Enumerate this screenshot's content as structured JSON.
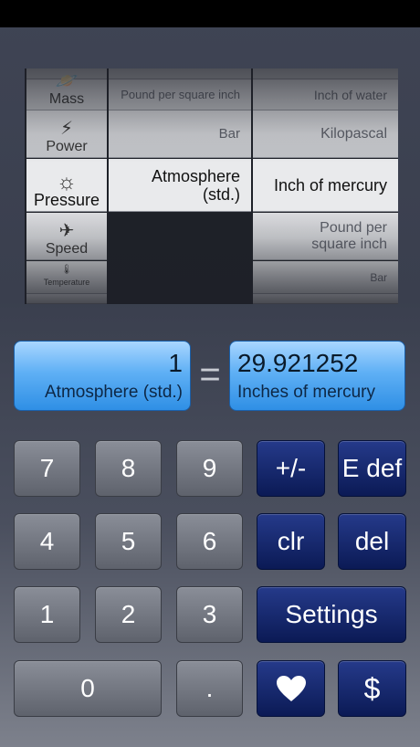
{
  "picker": {
    "categories": [
      {
        "label": "",
        "icon": "",
        "icon_name": "top-partial-icon"
      },
      {
        "label": "Mass",
        "icon": "🪐",
        "icon_name": "planet-icon"
      },
      {
        "label": "Power",
        "icon": "⚡",
        "icon_name": "lightning-icon"
      },
      {
        "label": "Pressure",
        "icon": "☼",
        "icon_name": "sun-icon"
      },
      {
        "label": "Speed",
        "icon": "✈",
        "icon_name": "airplane-icon"
      },
      {
        "label": "Temperature",
        "icon": "🌡",
        "icon_name": "thermometer-icon"
      }
    ],
    "from_units": [
      "Pound per square inch",
      "Bar",
      "Atmosphere (std.)"
    ],
    "to_units": [
      "Inch of water",
      "Kilopascal",
      "Inch of mercury",
      "Pound per square inch",
      "Bar"
    ],
    "selected_category": "Pressure",
    "selected_from": "Atmosphere (std.)",
    "selected_to": "Inch of mercury"
  },
  "display": {
    "from_value": "1",
    "from_unit": "Atmosphere (std.)",
    "equals": "=",
    "to_value": "29.921252",
    "to_unit": "Inches of mercury"
  },
  "keys": {
    "k7": "7",
    "k8": "8",
    "k9": "9",
    "k4": "4",
    "k5": "5",
    "k6": "6",
    "k1": "1",
    "k2": "2",
    "k3": "3",
    "k0": "0",
    "dot": ".",
    "plus_minus": "+/-",
    "e_def": "E def",
    "clr": "clr",
    "del": "del",
    "settings": "Settings",
    "dollar": "$"
  },
  "colors": {
    "display_blue": "#5fb0f5",
    "key_navy": "#0b1a55",
    "key_gray": "#6e727c"
  }
}
